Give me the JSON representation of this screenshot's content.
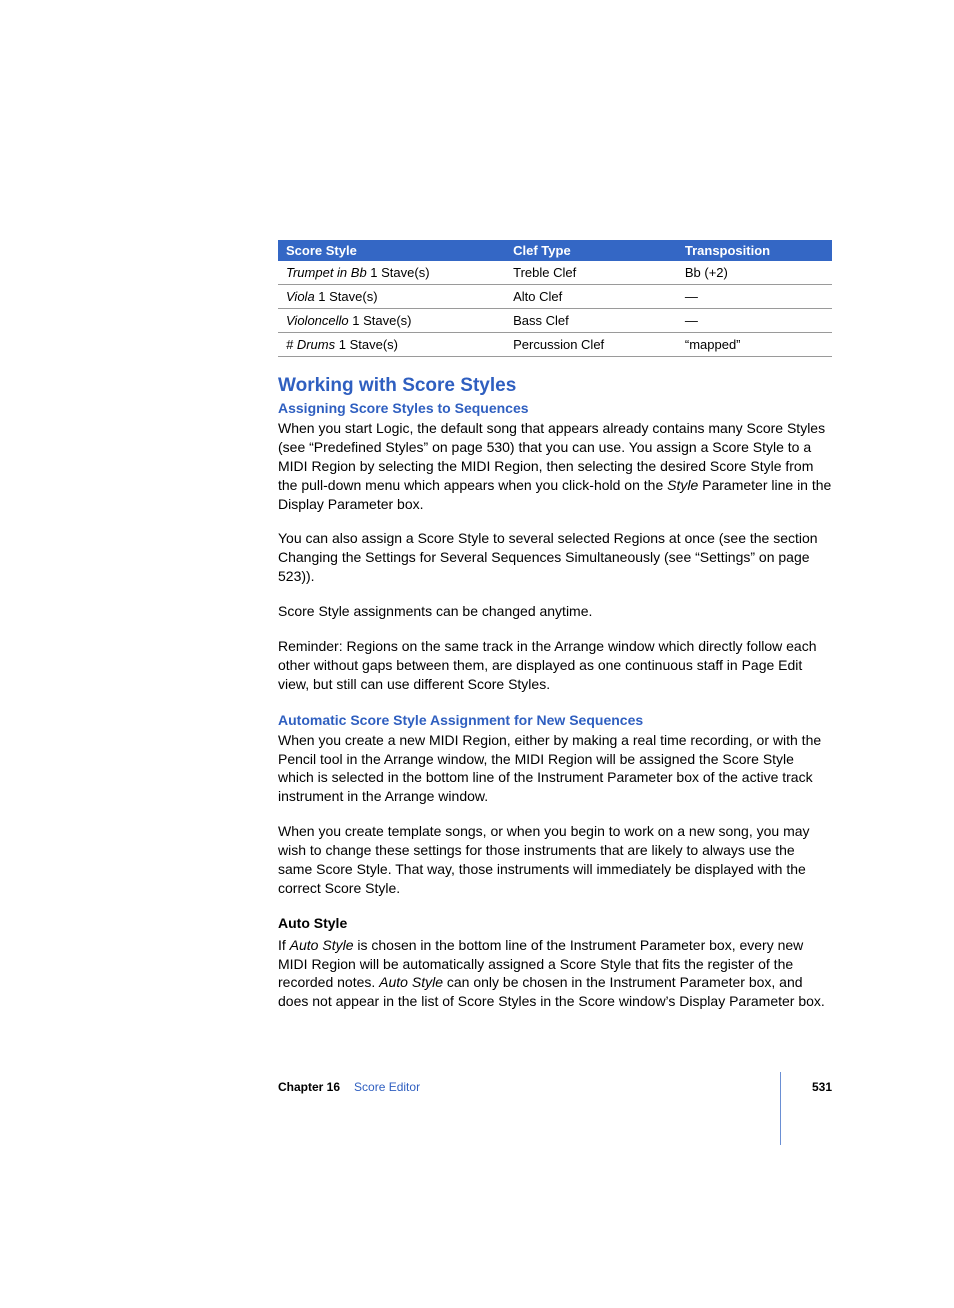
{
  "table": {
    "headers": [
      "Score Style",
      "Clef Type",
      "Transposition"
    ],
    "rows": [
      {
        "style_pre": "Trumpet in Bb ",
        "style_post": "1 Stave(s)",
        "clef": "Treble Clef",
        "trans": "Bb (+2)"
      },
      {
        "style_pre": "Viola ",
        "style_post": "1 Stave(s)",
        "clef": "Alto Clef",
        "trans": "—"
      },
      {
        "style_pre": "Violoncello ",
        "style_post": "1 Stave(s)",
        "clef": "Bass Clef",
        "trans": "—"
      },
      {
        "style_pre": "# Drums ",
        "style_post": "1 Stave(s)",
        "clef": "Percussion Clef",
        "trans": "“mapped”"
      }
    ]
  },
  "h2": "Working with Score Styles",
  "sec1": {
    "heading": "Assigning Score Styles to Sequences",
    "p1a": "When you start Logic, the default song that appears already contains many Score Styles (see “Predefined Styles” on page 530) that you can use. You assign a Score Style to a MIDI Region by selecting the MIDI Region, then selecting the desired Score Style from the pull-down menu which appears when you click-hold on the ",
    "p1i": "Style",
    "p1b": " Parameter line in the Display Parameter box.",
    "p2": "You can also assign a Score Style to several selected Regions at once (see the section Changing the Settings for Several Sequences Simultaneously (see “Settings” on page 523)).",
    "p3": "Score Style assignments can be changed anytime.",
    "p4": "Reminder:  Regions on the same track in the Arrange window which directly follow each other without gaps between them, are displayed as one continuous staff in Page Edit view, but still can use different Score Styles."
  },
  "sec2": {
    "heading": "Automatic Score Style Assignment for New Sequences",
    "p1": "When you create a new MIDI Region, either by making a real time recording, or with the Pencil tool in the Arrange window, the MIDI Region will be assigned the Score Style which is selected in the bottom line of the Instrument Parameter box of the active track instrument in the Arrange window.",
    "p2": "When you create template songs, or when you begin to work on a new song, you may wish to change these settings for those instruments that are likely to always use the same Score Style. That way, those instruments will immediately be displayed with the correct Score Style."
  },
  "sec3": {
    "heading": "Auto Style",
    "p1a": "If ",
    "p1i1": "Auto Style",
    "p1b": " is chosen in the bottom line of the Instrument Parameter box, every new MIDI Region will be automatically assigned a Score Style that fits the register of the recorded notes. ",
    "p1i2": "Auto Style",
    "p1c": " can only be chosen in the Instrument Parameter box, and does not appear in the list of Score Styles in the Score window’s Display Parameter box."
  },
  "footer": {
    "chapter": "Chapter 16",
    "title": "Score Editor",
    "page": "531"
  }
}
